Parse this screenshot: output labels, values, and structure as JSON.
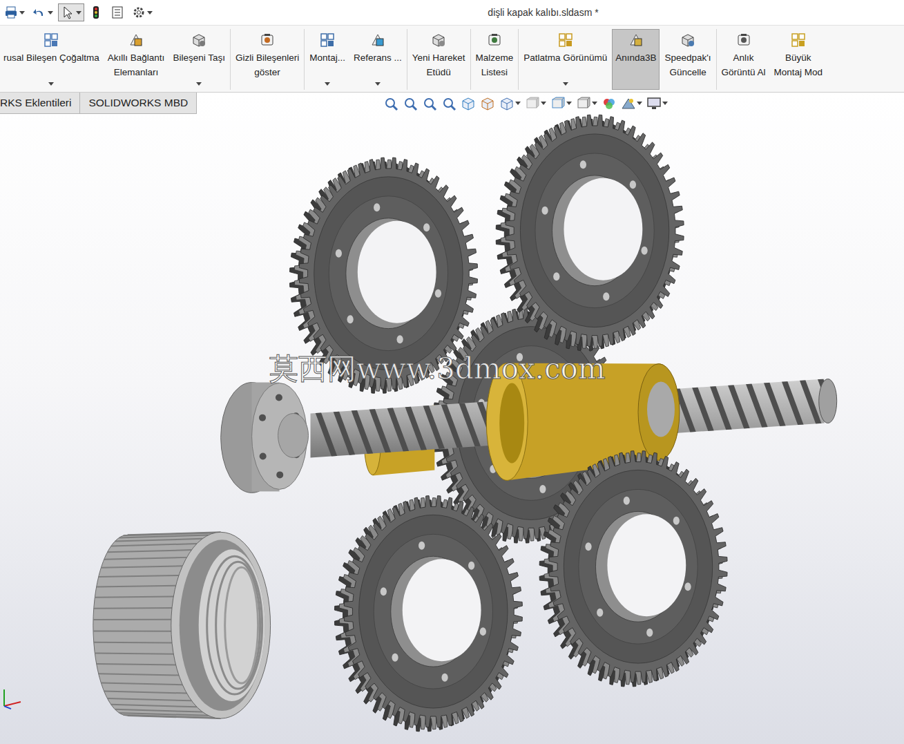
{
  "window": {
    "title": "dişli kapak kalıbı.sldasm *"
  },
  "quick_access": {
    "select_tool_active": true
  },
  "command_groups": [
    [
      {
        "lines": [
          "rusal Bileşen Çoğaltma"
        ],
        "dropdown": true,
        "selected": false
      },
      {
        "lines": [
          "Akıllı Bağlantı",
          "Elemanları"
        ],
        "dropdown": false,
        "selected": false
      },
      {
        "lines": [
          "Bileşeni Taşı"
        ],
        "dropdown": true,
        "selected": false
      }
    ],
    [
      {
        "lines": [
          "Gizli Bileşenleri",
          "göster"
        ],
        "dropdown": false,
        "selected": false
      }
    ],
    [
      {
        "lines": [
          "Montaj..."
        ],
        "dropdown": true,
        "selected": false
      },
      {
        "lines": [
          "Referans ..."
        ],
        "dropdown": true,
        "selected": false
      }
    ],
    [
      {
        "lines": [
          "Yeni Hareket",
          "Etüdü"
        ],
        "dropdown": false,
        "selected": false
      }
    ],
    [
      {
        "lines": [
          "Malzeme",
          "Listesi"
        ],
        "dropdown": false,
        "selected": false
      }
    ],
    [
      {
        "lines": [
          "Patlatma Görünümü"
        ],
        "dropdown": true,
        "selected": false
      },
      {
        "lines": [
          "Anında3B"
        ],
        "dropdown": false,
        "selected": true
      },
      {
        "lines": [
          "Speedpak'ı",
          "Güncelle"
        ],
        "dropdown": false,
        "selected": false
      }
    ],
    [
      {
        "lines": [
          "Anlık",
          "Görüntü Al"
        ],
        "dropdown": false,
        "selected": false
      },
      {
        "lines": [
          "Büyük",
          "Montaj Mod"
        ],
        "dropdown": false,
        "selected": false
      }
    ]
  ],
  "tabs": [
    {
      "label": "RKS Eklentileri",
      "selected": false
    },
    {
      "label": "SOLIDWORKS MBD",
      "selected": false
    }
  ],
  "watermark": "莫西网www.3dmox.com"
}
